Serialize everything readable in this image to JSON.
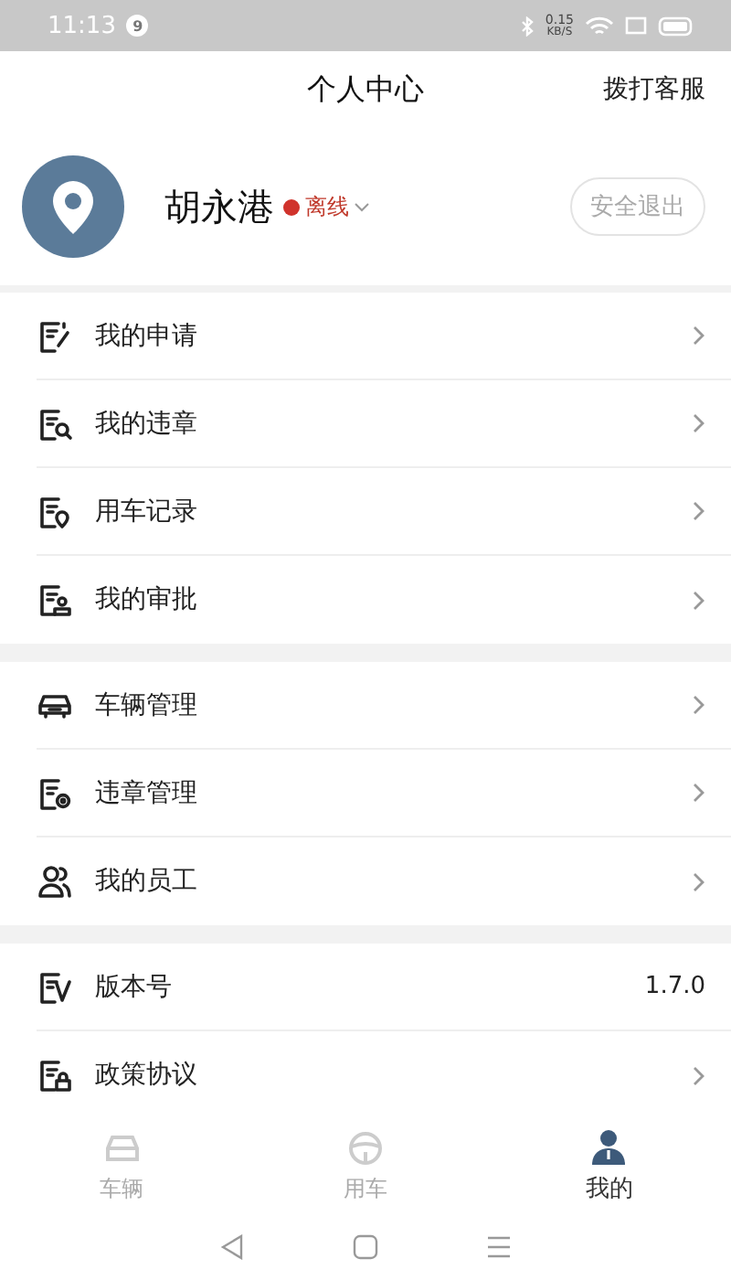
{
  "status_bar": {
    "time": "11:13",
    "notification_count": "9",
    "net_speed": "0.15",
    "net_unit": "KB/S"
  },
  "header": {
    "title": "个人中心",
    "action": "拨打客服"
  },
  "profile": {
    "name": "胡永港",
    "status": "离线",
    "online": false,
    "logout": "安全退出"
  },
  "groups": [
    {
      "items": [
        {
          "kind": "link",
          "label": "我的申请"
        },
        {
          "kind": "link",
          "label": "我的违章"
        },
        {
          "kind": "link",
          "label": "用车记录"
        },
        {
          "kind": "link",
          "label": "我的审批"
        }
      ]
    },
    {
      "items": [
        {
          "kind": "link",
          "label": "车辆管理"
        },
        {
          "kind": "link",
          "label": "违章管理"
        },
        {
          "kind": "link",
          "label": "我的员工"
        }
      ]
    },
    {
      "items": [
        {
          "kind": "value",
          "label": "版本号",
          "value": "1.7.0"
        },
        {
          "kind": "link",
          "label": "政策协议"
        }
      ]
    }
  ],
  "tabs": [
    {
      "label": "车辆",
      "selected": false
    },
    {
      "label": "用车",
      "selected": false
    },
    {
      "label": "我的",
      "selected": true
    }
  ]
}
